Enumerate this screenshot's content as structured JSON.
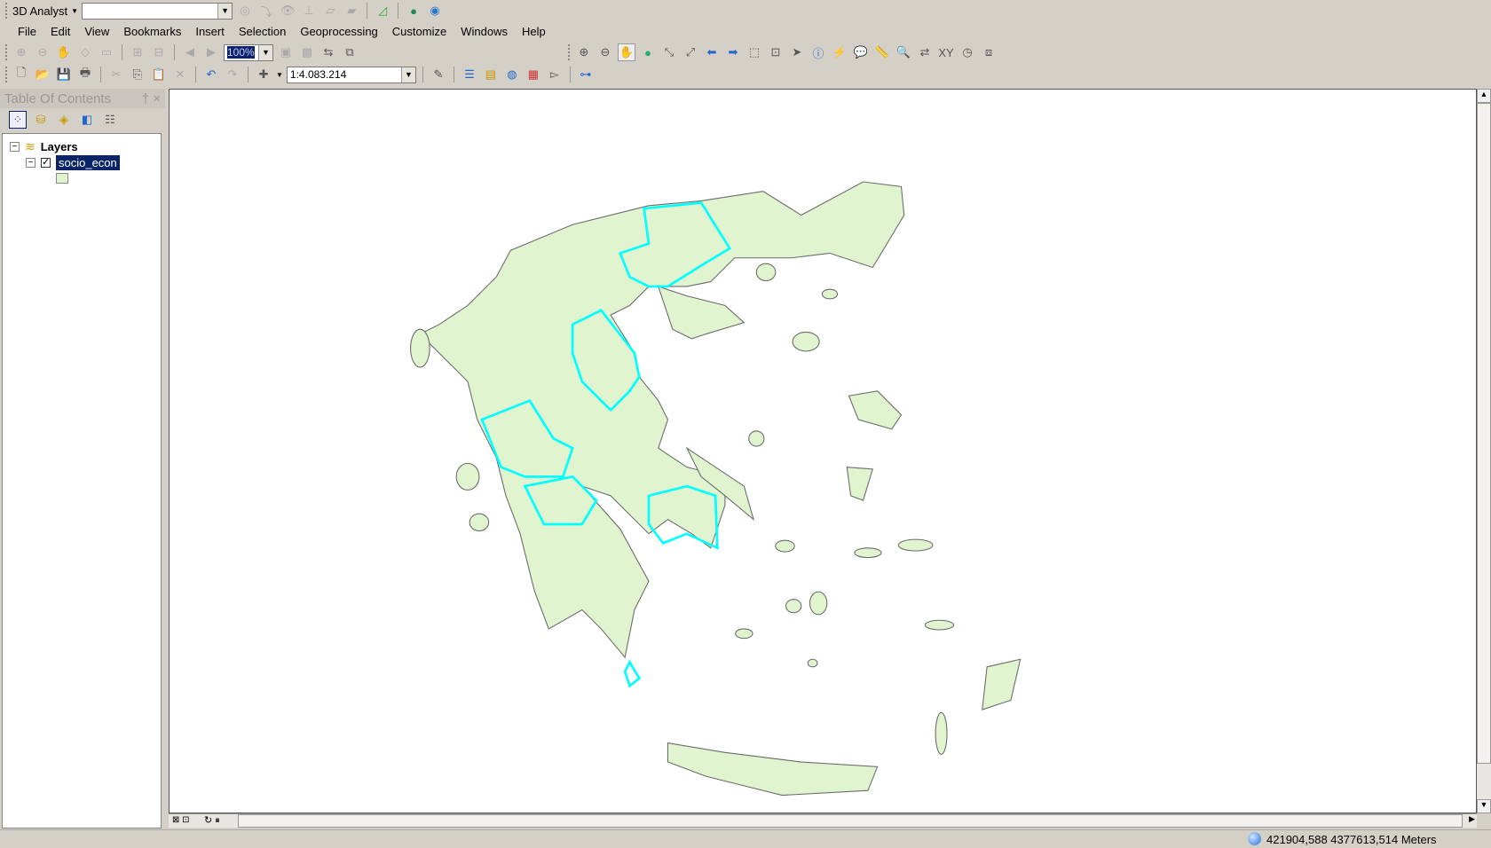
{
  "toolbar_3d": {
    "label": "3D Analyst",
    "layer_combo": ""
  },
  "menu": [
    "File",
    "Edit",
    "View",
    "Bookmarks",
    "Insert",
    "Selection",
    "Geoprocessing",
    "Customize",
    "Windows",
    "Help"
  ],
  "layout_toolbar": {
    "zoom": "100%"
  },
  "standard_toolbar": {
    "scale": "1:4.083.214"
  },
  "toc": {
    "title": "Table Of Contents",
    "root": "Layers",
    "layer": "socio_econ",
    "pin": "†",
    "close": "×"
  },
  "status": {
    "coords": "421904,588  4377613,514 Meters"
  },
  "colors": {
    "fill": "#e0f5cf",
    "outline": "#6b6b6b",
    "selection": "#00ffff",
    "highlight": "#0a246a"
  }
}
